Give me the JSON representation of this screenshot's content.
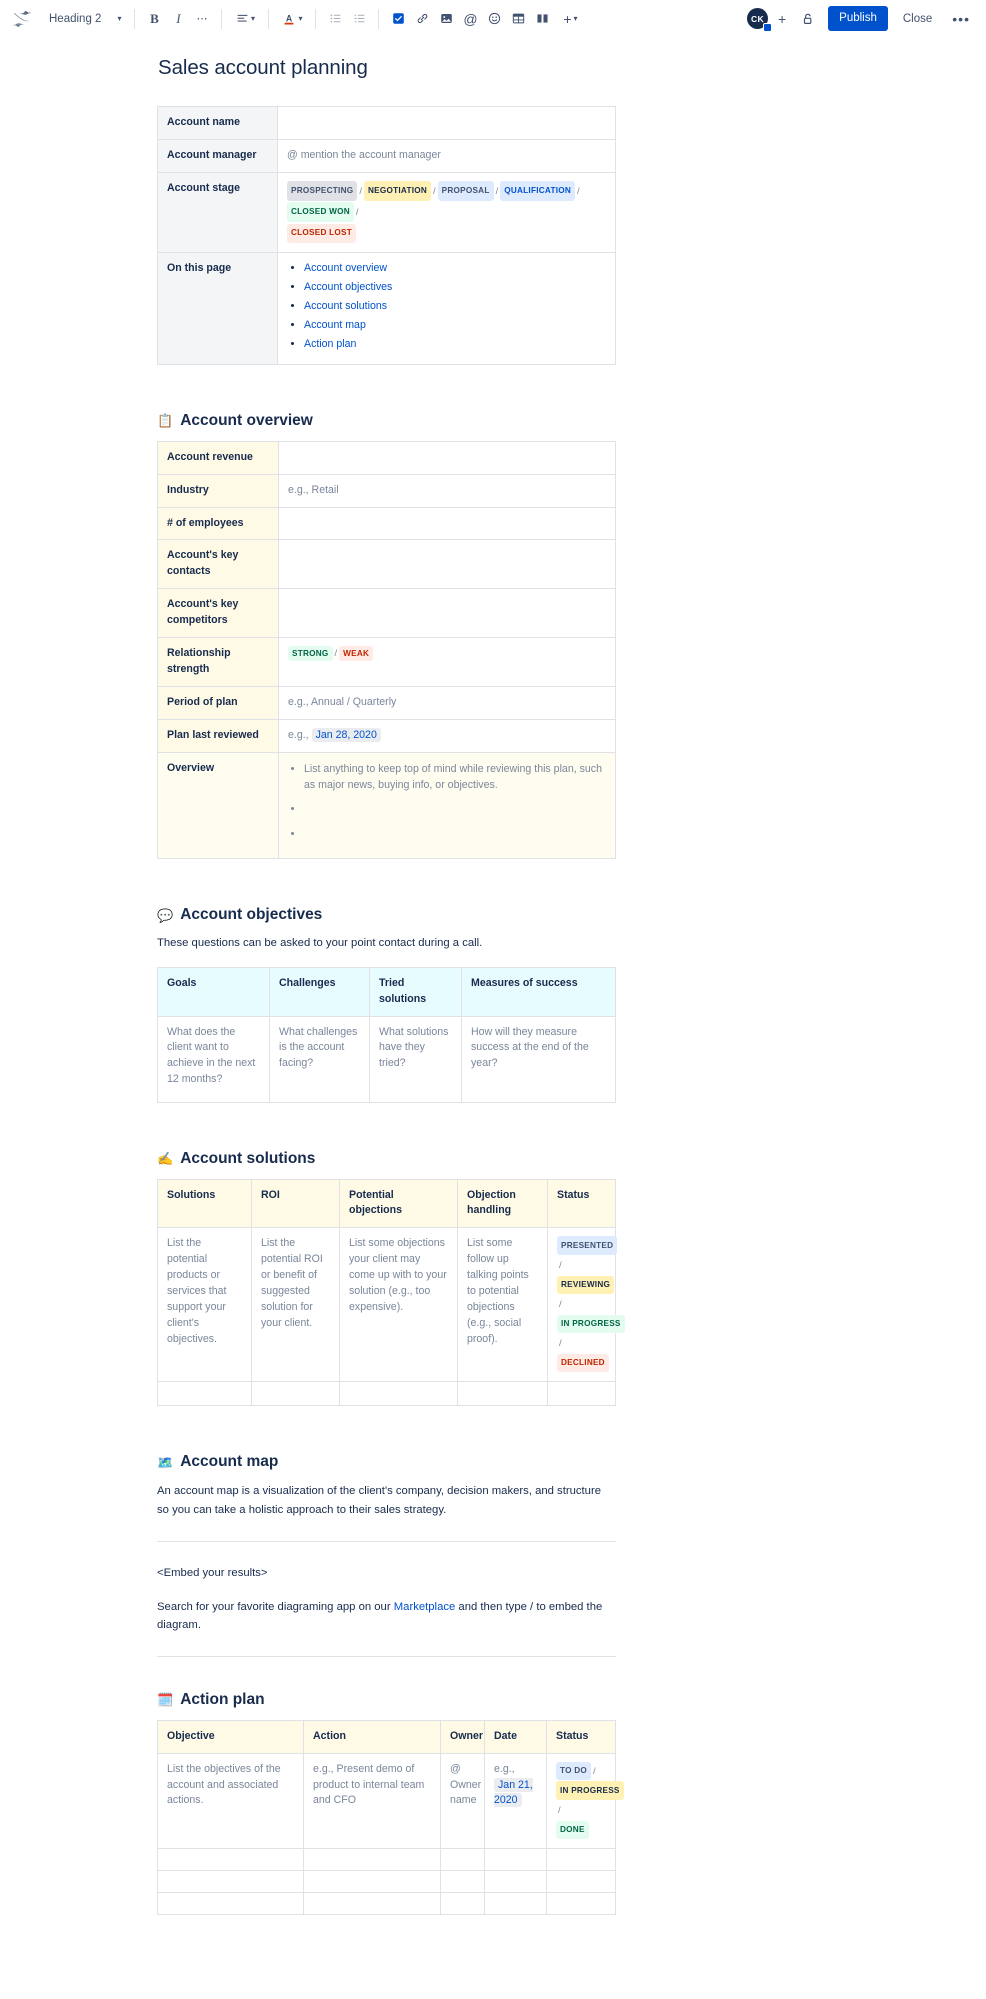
{
  "toolbar": {
    "logo_icon": "confluence-logo-icon",
    "style_select": {
      "value": "Heading 2",
      "icon": "chevron-down-icon"
    },
    "buttons": [
      {
        "name": "bold-button",
        "label": "B"
      },
      {
        "name": "italic-button",
        "label": "I"
      },
      {
        "name": "more-formatting-button",
        "label": "•••"
      },
      {
        "name": "text-align-button",
        "label": "align"
      },
      {
        "name": "text-color-button",
        "label": "A"
      },
      {
        "name": "bullet-list-button",
        "label": "list"
      },
      {
        "name": "numbered-list-button",
        "label": "ordered-list"
      },
      {
        "name": "task-list-button",
        "label": "task"
      },
      {
        "name": "link-button",
        "label": "link"
      },
      {
        "name": "image-button",
        "label": "image"
      },
      {
        "name": "mention-button",
        "label": "@"
      },
      {
        "name": "emoji-button",
        "label": "emoji"
      },
      {
        "name": "table-button",
        "label": "table"
      },
      {
        "name": "layout-button",
        "label": "layout"
      },
      {
        "name": "insert-more-button",
        "label": "+"
      }
    ],
    "avatar_initials": "CK",
    "add_people_label": "+",
    "restrictions_icon": "unlock-icon",
    "publish_label": "Publish",
    "close_label": "Close",
    "more_label": "•••"
  },
  "document": {
    "title": "Sales account planning"
  },
  "summary_table": {
    "rows": [
      {
        "label": "Account name",
        "value": ""
      },
      {
        "label": "Account manager",
        "value": "@ mention the account manager"
      },
      {
        "label": "Account stage",
        "value": ""
      },
      {
        "label": "On this page",
        "value": ""
      }
    ],
    "stages": [
      {
        "text": "PROSPECTING",
        "style": "lz-gray"
      },
      {
        "text": "NEGOTIATION",
        "style": "lz-yellow"
      },
      {
        "text": "PROPOSAL",
        "style": "lz-blue-l"
      },
      {
        "text": "QUALIFICATION",
        "style": "lz-blue"
      },
      {
        "text": "CLOSED WON",
        "style": "lz-green"
      },
      {
        "text": "CLOSED LOST",
        "style": "lz-red"
      }
    ],
    "toc": [
      "Account overview",
      "Account objectives",
      "Account solutions",
      "Account map",
      "Action plan"
    ]
  },
  "account_overview": {
    "emoji": "📋",
    "emoji_name": "clipboard-emoji",
    "heading": "Account overview",
    "rows": [
      {
        "label": "Account revenue",
        "value": ""
      },
      {
        "label": "Industry",
        "value": "e.g., Retail"
      },
      {
        "label": "# of employees",
        "value": ""
      },
      {
        "label": "Account's key contacts",
        "value": ""
      },
      {
        "label": "Account's key competitors",
        "value": ""
      },
      {
        "label": "Relationship strength",
        "value": ""
      },
      {
        "label": "Period of plan",
        "value": "e.g., Annual / Quarterly"
      },
      {
        "label": "Plan last reviewed",
        "value": ""
      },
      {
        "label": "Overview",
        "value": ""
      }
    ],
    "relationship": [
      {
        "text": "STRONG",
        "style": "lz-green"
      },
      {
        "text": "WEAK",
        "style": "lz-red"
      }
    ],
    "plan_reviewed_prefix": "e.g.,",
    "plan_reviewed_date": "Jan 28, 2020",
    "overview_bullets": [
      "List anything to keep top of mind while reviewing this plan, such as major news, buying info, or objectives.",
      "",
      ""
    ]
  },
  "account_objectives": {
    "emoji": "💬",
    "emoji_name": "speech-balloon-emoji",
    "heading": "Account objectives",
    "intro": "These questions can be asked to your point contact during a call.",
    "headers": [
      "Goals",
      "Challenges",
      "Tried solutions",
      "Measures of success"
    ],
    "row": [
      "What does the client want to achieve in the next 12 months?",
      "What challenges is the account facing?",
      "What solutions have they tried?",
      "How will they measure success at the end of the year?"
    ]
  },
  "account_solutions": {
    "emoji": "✍️",
    "emoji_name": "writing-hand-emoji",
    "heading": "Account solutions",
    "headers": [
      "Solutions",
      "ROI",
      "Potential objections",
      "Objection handling",
      "Status"
    ],
    "row": [
      "List the potential products or services that support your client's objectives.",
      "List the potential ROI or benefit of suggested solution for your client.",
      "List some objections your client may come up with to your solution (e.g., too expensive).",
      "List some follow up talking points to potential objections (e.g., social proof)."
    ],
    "statuses": [
      {
        "text": "PRESENTED",
        "style": "lz-blue-l"
      },
      {
        "text": "REVIEWING",
        "style": "lz-yellow2"
      },
      {
        "text": "IN PROGRESS",
        "style": "lz-green"
      },
      {
        "text": "DECLINED",
        "style": "lz-red"
      }
    ]
  },
  "account_map": {
    "emoji": "🗺️",
    "emoji_name": "world-map-emoji",
    "heading": "Account map",
    "paragraph": "An account map is a visualization of the client's company, decision makers, and structure so you can take a holistic approach to their sales strategy.",
    "embed_placeholder": "<Embed your results>",
    "footer_pre": "Search for your favorite diagraming app on our ",
    "footer_link": "Marketplace",
    "footer_post": " and then type / to embed the diagram."
  },
  "action_plan": {
    "emoji": "🗓️",
    "emoji_name": "spiral-calendar-emoji",
    "heading": "Action plan",
    "headers": [
      "Objective",
      "Action",
      "Owner",
      "Date",
      "Status"
    ],
    "row": {
      "objective": "List the objectives of the account and associated actions.",
      "action": "e.g., Present demo of product to internal team and CFO",
      "owner": "@ Owner name",
      "date_prefix": "e.g.,",
      "date": "Jan 21, 2020"
    },
    "statuses": [
      {
        "text": "TO DO",
        "style": "lz-blue-l"
      },
      {
        "text": "IN PROGRESS",
        "style": "lz-yellow2"
      },
      {
        "text": "DONE",
        "style": "lz-green"
      }
    ]
  }
}
